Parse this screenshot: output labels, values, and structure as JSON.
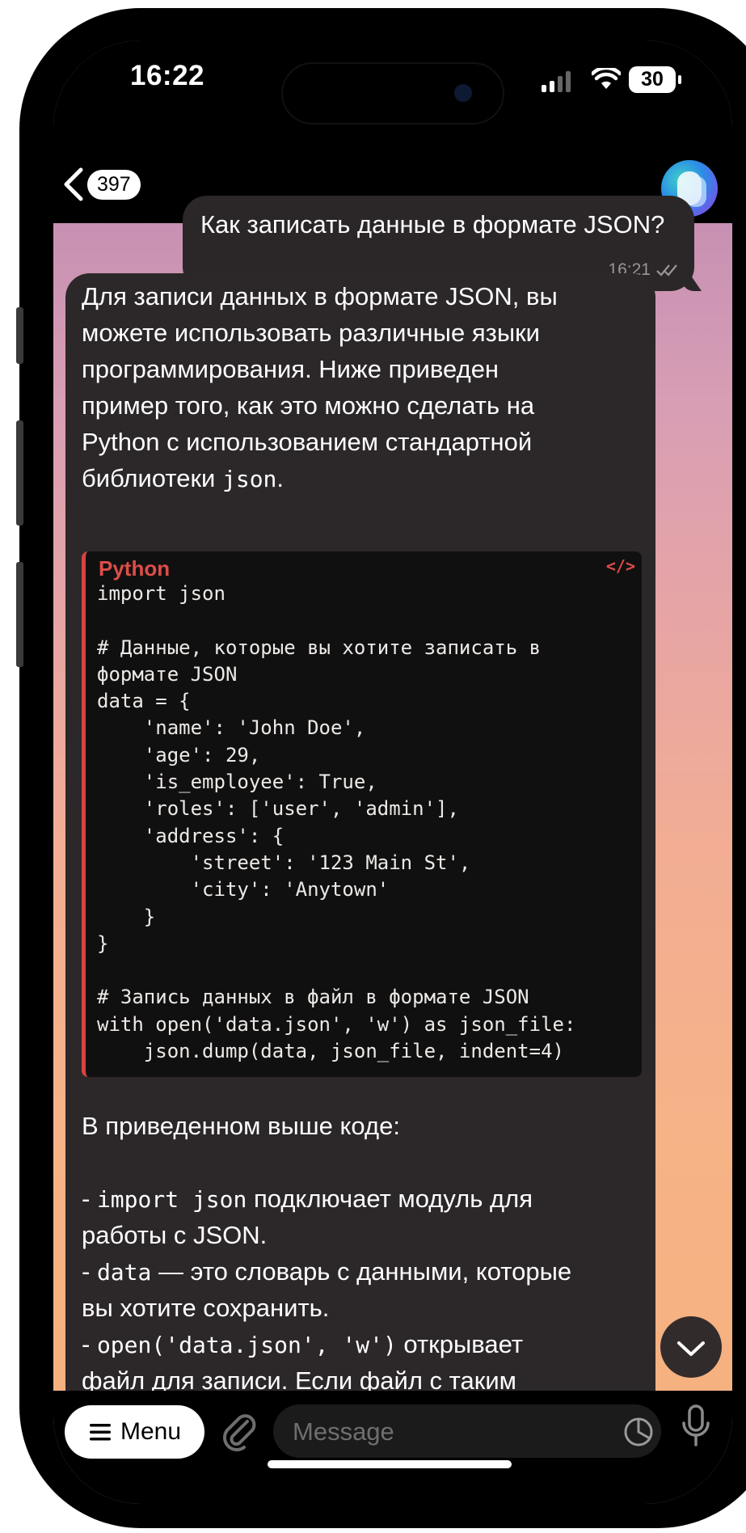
{
  "status_bar": {
    "time": "16:22",
    "battery": "30"
  },
  "nav": {
    "back_count": "397"
  },
  "outgoing": {
    "text": "Как записать данные в формате JSON?",
    "time": "16:21"
  },
  "incoming": {
    "intro_lines": [
      "Для записи данных в формате JSON, вы",
      "можете использовать различные языки",
      "программирования. Ниже приведен",
      "пример того, как это можно сделать на",
      "Python с использованием стандартной"
    ],
    "intro_last_prefix": "библиотеки ",
    "intro_last_code": "json",
    "intro_last_suffix": ".",
    "code_language": "Python",
    "code_icon": "</>",
    "code": "import json\n\n# Данные, которые вы хотите записать в\nформате JSON\ndata = {\n    'name': 'John Doe',\n    'age': 29,\n    'is_employee': True,\n    'roles': ['user', 'admin'],\n    'address': {\n        'street': '123 Main St',\n        'city': 'Anytown'\n    }\n}\n\n# Запись данных в файл в формате JSON\nwith open('data.json', 'w') as json_file:\n    json.dump(data, json_file, indent=4)",
    "after_code": "В приведенном выше коде:",
    "b1_prefix": "- ",
    "b1_code": "import json",
    "b1_text": " подключает модуль для",
    "b1_line2": "работы с JSON.",
    "b2_prefix": "- ",
    "b2_code": "data",
    "b2_text": " — это словарь с данными, которые",
    "b2_line2": "вы хотите сохранить.",
    "b3_prefix": "- ",
    "b3_code": "open('data.json', 'w')",
    "b3_text": " открывает",
    "b3_line2": "файл для записи. Если файл с таким"
  },
  "input_bar": {
    "menu_label": "Menu",
    "placeholder": "Message"
  },
  "icons": {
    "back": "chevron-left-icon",
    "read_receipt": "double-check-icon",
    "scroll_down": "chevron-down-icon",
    "menu": "hamburger-icon",
    "attach": "paperclip-icon",
    "sticker": "sticker-icon",
    "mic": "microphone-icon"
  },
  "colors": {
    "code_accent": "#dd4d48",
    "bubble": "#2c2728"
  }
}
